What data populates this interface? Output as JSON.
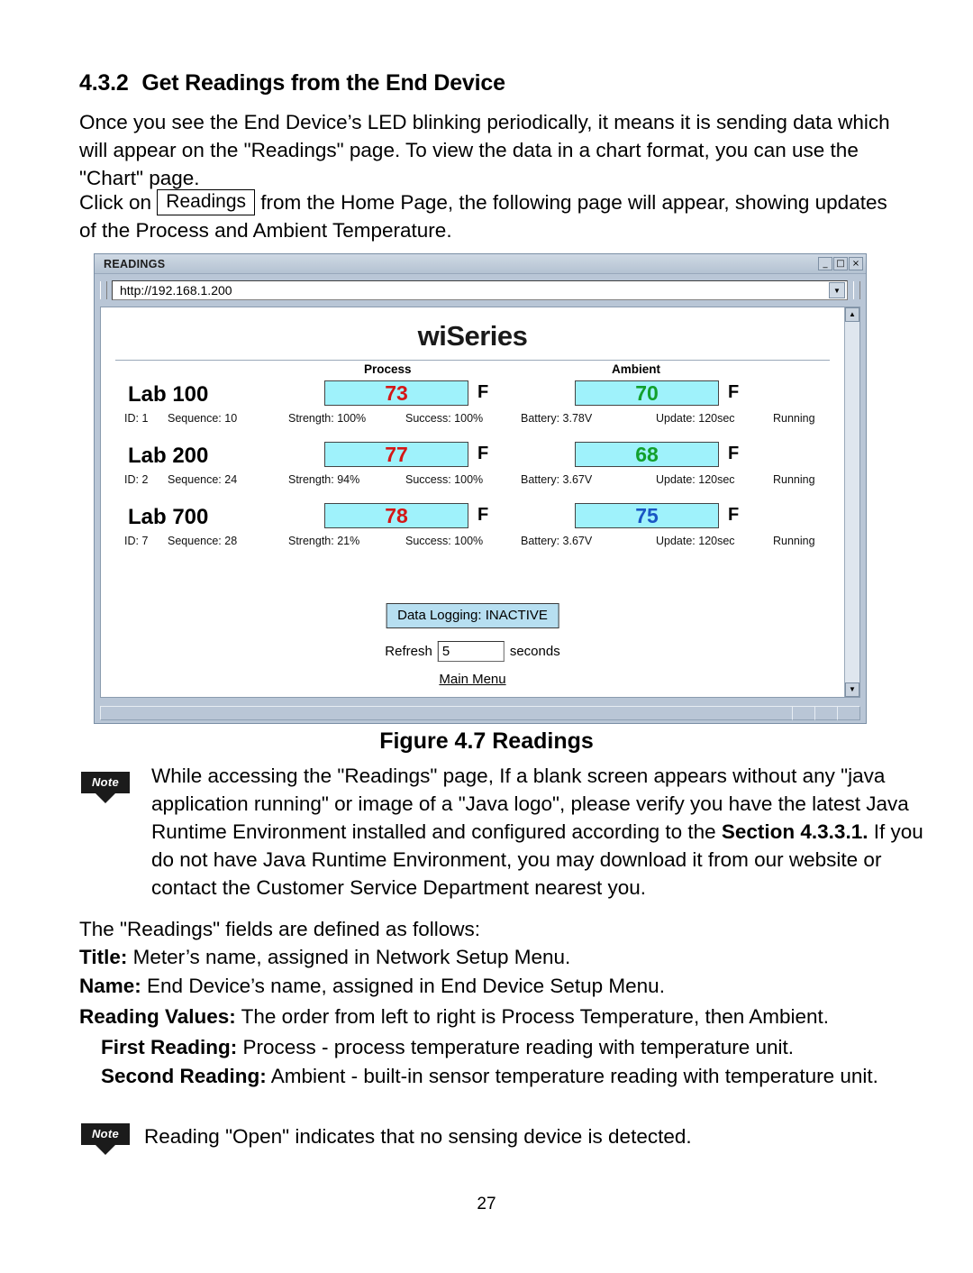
{
  "section": {
    "number": "4.3.2",
    "title": "Get Readings from the End Device"
  },
  "paragraphs": {
    "intro": "Once you see the End Device’s LED blinking periodically, it means it is sending data which will appear on the \"Readings\" page. To view the data in a chart format, you can use the \"Chart\" page.",
    "click_prefix": "Click on",
    "readings_button": "Readings",
    "click_suffix": "from the Home Page, the following page will appear, showing updates of the Process and Ambient Temperature."
  },
  "window": {
    "title": "READINGS",
    "buttons": {
      "minimize": "_",
      "maximize": "□",
      "close": "×"
    },
    "address": "http://192.168.1.200",
    "address_dropdown": "▼",
    "scroll_up": "▲",
    "scroll_down": "▼"
  },
  "app": {
    "brand": "wiSeries",
    "column_headers": {
      "process": "Process",
      "ambient": "Ambient"
    },
    "rows": [
      {
        "name": "Lab 100",
        "process_value": "73",
        "process_unit": "F",
        "process_color": "red",
        "ambient_value": "70",
        "ambient_unit": "F",
        "ambient_color": "green",
        "id": "ID: 1",
        "sequence": "Sequence: 10",
        "strength": "Strength: 100%",
        "success": "Success: 100%",
        "battery": "Battery: 3.78V",
        "update": "Update: 120sec",
        "status": "Running"
      },
      {
        "name": "Lab 200",
        "process_value": "77",
        "process_unit": "F",
        "process_color": "red",
        "ambient_value": "68",
        "ambient_unit": "F",
        "ambient_color": "green",
        "id": "ID: 2",
        "sequence": "Sequence: 24",
        "strength": "Strength: 94%",
        "success": "Success: 100%",
        "battery": "Battery: 3.67V",
        "update": "Update: 120sec",
        "status": "Running"
      },
      {
        "name": "Lab 700",
        "process_value": "78",
        "process_unit": "F",
        "process_color": "red",
        "ambient_value": "75",
        "ambient_unit": "F",
        "ambient_color": "blue",
        "id": "ID: 7",
        "sequence": "Sequence: 28",
        "strength": "Strength: 21%",
        "success": "Success: 100%",
        "battery": "Battery: 3.67V",
        "update": "Update: 120sec",
        "status": "Running"
      }
    ],
    "data_logging": "Data Logging: INACTIVE",
    "refresh_label": "Refresh",
    "refresh_value": "5",
    "refresh_unit": "seconds",
    "main_menu": "Main Menu"
  },
  "figure_caption": "Figure 4.7  Readings",
  "notes": {
    "icon_label": "Note",
    "note1_line1": "While accessing the \"Readings\" page, If a blank screen appears without",
    "note1_line2": "any \"java application running\" or image of a \"Java logo\", please verify you",
    "note1_line3": "have the latest Java Runtime Environment installed and configured",
    "note1_line4_a": "according to the ",
    "note1_line4_bold": "Section 4.3.3.1.",
    "note1_line4_b": " If you do not have Java Runtime",
    "note1_line5": "Environment, you may download it from our website or contact the",
    "note1_line6": "Customer Service Department nearest you.",
    "note2": "Reading \"Open\" indicates that no sensing device is detected."
  },
  "definitions": {
    "lead": "The \"Readings\" fields are defined as follows:",
    "title_label": "Title:",
    "title_text": " Meter’s name, assigned in Network Setup Menu.",
    "name_label": "Name:",
    "name_text": " End Device’s name, assigned in End Device Setup Menu.",
    "values_label": "Reading Values:",
    "values_text": " The order from left to right is Process Temperature, then Ambient.",
    "first_label": "First Reading:",
    "first_text": " Process - process temperature reading with temperature unit.",
    "second_label": "Second Reading:",
    "second_text": " Ambient - built-in sensor temperature reading with temperature unit."
  },
  "page_number": "27"
}
